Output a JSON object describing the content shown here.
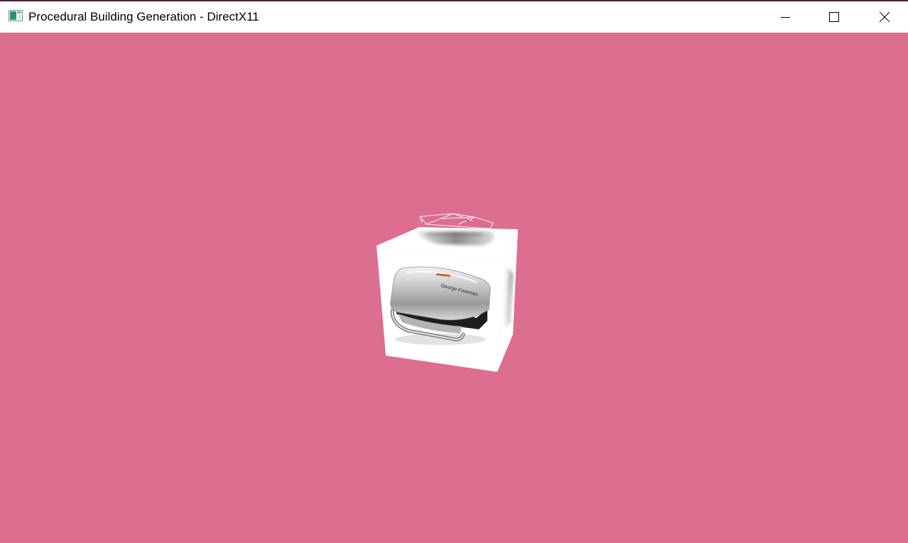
{
  "window": {
    "title": "Procedural Building Generation - DirectX11",
    "controls": {
      "minimize_icon": "minimize-icon",
      "maximize_icon": "maximize-icon",
      "close_icon": "close-icon"
    }
  },
  "viewport": {
    "clear_color": "#dc6e8f",
    "cube_texture_text": "George Foreman"
  },
  "colors": {
    "window_border": "#5a1a44",
    "titlebar_bg": "#ffffff",
    "title_text": "#000000"
  }
}
